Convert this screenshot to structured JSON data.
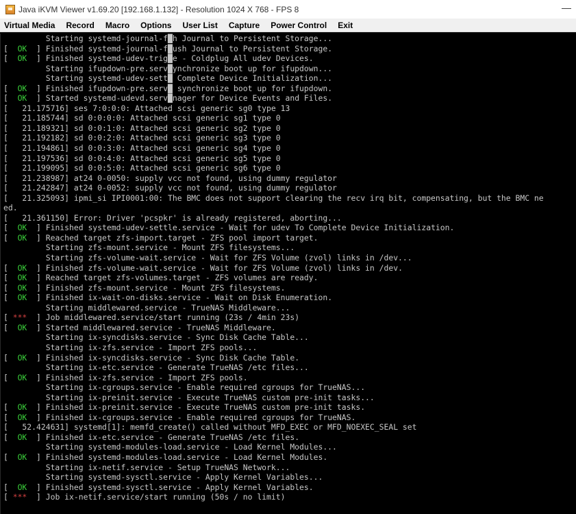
{
  "window": {
    "title": "Java iKVM Viewer v1.69.20 [192.168.1.132]  - Resolution 1024 X 768 - FPS 8",
    "minimize_symbol": "—"
  },
  "menu": {
    "items": [
      "Virtual Media",
      "Record",
      "Macro",
      "Options",
      "User List",
      "Capture",
      "Power Control",
      "Exit"
    ]
  },
  "console": {
    "ok_tag": "  OK  ",
    "star_tag": " ***  ",
    "lines": [
      {
        "status": "none",
        "text": "         Starting systemd-journal-f█h Journal to Persistent Storage..."
      },
      {
        "status": "ok",
        "text": "Finished systemd-journal-f█ush Journal to Persistent Storage."
      },
      {
        "status": "ok",
        "text": "Finished systemd-udev-trig█e - Coldplug All udev Devices."
      },
      {
        "status": "none",
        "text": "         Starting ifupdown-pre.serv█ynchronize boot up for ifupdown..."
      },
      {
        "status": "none",
        "text": "         Starting systemd-udev-sett█ Complete Device Initialization..."
      },
      {
        "status": "ok",
        "text": "Finished ifupdown-pre.serv█ synchronize boot up for ifupdown."
      },
      {
        "status": "ok",
        "text": "Started systemd-udevd.serv█nager for Device Events and Files."
      },
      {
        "status": "none",
        "text": "[   21.175716] ses 7:0:0:0: Attached scsi generic sg0 type 13"
      },
      {
        "status": "none",
        "text": "[   21.185744] sd 0:0:0:0: Attached scsi generic sg1 type 0"
      },
      {
        "status": "none",
        "text": "[   21.189321] sd 0:0:1:0: Attached scsi generic sg2 type 0"
      },
      {
        "status": "none",
        "text": "[   21.192182] sd 0:0:2:0: Attached scsi generic sg3 type 0"
      },
      {
        "status": "none",
        "text": "[   21.194861] sd 0:0:3:0: Attached scsi generic sg4 type 0"
      },
      {
        "status": "none",
        "text": "[   21.197536] sd 0:0:4:0: Attached scsi generic sg5 type 0"
      },
      {
        "status": "none",
        "text": "[   21.199095] sd 0:0:5:0: Attached scsi generic sg6 type 0"
      },
      {
        "status": "none",
        "text": "[   21.238987] at24 0-0050: supply vcc not found, using dummy regulator"
      },
      {
        "status": "none",
        "text": "[   21.242847] at24 0-0052: supply vcc not found, using dummy regulator"
      },
      {
        "status": "none",
        "text": "[   21.325093] ipmi_si IPI0001:00: The BMC does not support clearing the recv irq bit, compensating, but the BMC ne"
      },
      {
        "status": "none",
        "text": "ed."
      },
      {
        "status": "none",
        "text": "[   21.361150] Error: Driver 'pcspkr' is already registered, aborting..."
      },
      {
        "status": "ok",
        "text": "Finished systemd-udev-settle.service - Wait for udev To Complete Device Initialization."
      },
      {
        "status": "ok",
        "text": "Reached target zfs-import.target - ZFS pool import target."
      },
      {
        "status": "none",
        "text": "         Starting zfs-mount.service - Mount ZFS filesystems..."
      },
      {
        "status": "none",
        "text": "         Starting zfs-volume-wait.service - Wait for ZFS Volume (zvol) links in /dev..."
      },
      {
        "status": "ok",
        "text": "Finished zfs-volume-wait.service - Wait for ZFS Volume (zvol) links in /dev."
      },
      {
        "status": "ok",
        "text": "Reached target zfs-volumes.target - ZFS volumes are ready."
      },
      {
        "status": "ok",
        "text": "Finished zfs-mount.service - Mount ZFS filesystems."
      },
      {
        "status": "ok",
        "text": "Finished ix-wait-on-disks.service - Wait on Disk Enumeration."
      },
      {
        "status": "none",
        "text": "         Starting middlewared.service - TrueNAS Middleware..."
      },
      {
        "status": "star",
        "text": "Job middlewared.service/start running (23s / 4min 23s)"
      },
      {
        "status": "ok",
        "text": "Started middlewared.service - TrueNAS Middleware."
      },
      {
        "status": "none",
        "text": "         Starting ix-syncdisks.service - Sync Disk Cache Table..."
      },
      {
        "status": "none",
        "text": "         Starting ix-zfs.service - Import ZFS pools..."
      },
      {
        "status": "ok",
        "text": "Finished ix-syncdisks.service - Sync Disk Cache Table."
      },
      {
        "status": "none",
        "text": "         Starting ix-etc.service - Generate TrueNAS /etc files..."
      },
      {
        "status": "ok",
        "text": "Finished ix-zfs.service - Import ZFS pools."
      },
      {
        "status": "none",
        "text": "         Starting ix-cgroups.service - Enable required cgroups for TrueNAS..."
      },
      {
        "status": "none",
        "text": "         Starting ix-preinit.service - Execute TrueNAS custom pre-init tasks..."
      },
      {
        "status": "ok",
        "text": "Finished ix-preinit.service - Execute TrueNAS custom pre-init tasks."
      },
      {
        "status": "ok",
        "text": "Finished ix-cgroups.service - Enable required cgroups for TrueNAS."
      },
      {
        "status": "none",
        "text": "[   52.424631] systemd[1]: memfd_create() called without MFD_EXEC or MFD_NOEXEC_SEAL set"
      },
      {
        "status": "ok",
        "text": "Finished ix-etc.service - Generate TrueNAS /etc files."
      },
      {
        "status": "none",
        "text": "         Starting systemd-modules-load.service - Load Kernel Modules..."
      },
      {
        "status": "ok",
        "text": "Finished systemd-modules-load.service - Load Kernel Modules."
      },
      {
        "status": "none",
        "text": "         Starting ix-netif.service - Setup TrueNAS Network..."
      },
      {
        "status": "none",
        "text": "         Starting systemd-sysctl.service - Apply Kernel Variables..."
      },
      {
        "status": "ok",
        "text": "Finished systemd-sysctl.service - Apply Kernel Variables."
      },
      {
        "status": "star",
        "text": "Job ix-netif.service/start running (50s / no limit)"
      }
    ]
  }
}
